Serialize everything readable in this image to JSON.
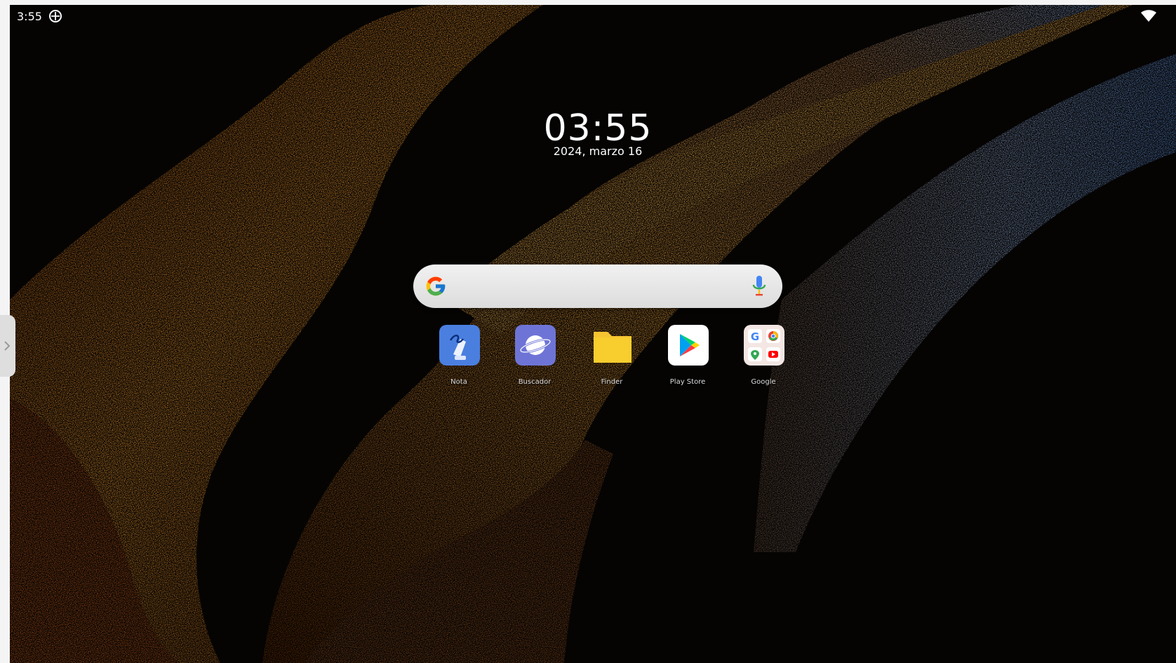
{
  "status_bar": {
    "time": "3:55",
    "sync_icon": "sync-icon",
    "wifi_icon": "wifi-icon"
  },
  "clock_widget": {
    "time": "03:55",
    "date": "2024, marzo 16"
  },
  "search_bar": {
    "logo_icon": "google-g-icon",
    "mic_icon": "mic-icon"
  },
  "apps": [
    {
      "label": "Nota",
      "icon": "notes-icon",
      "color": "#4a7fe0"
    },
    {
      "label": "Buscador",
      "icon": "browser-planet-icon",
      "color": "#6e74d6"
    },
    {
      "label": "Finder",
      "icon": "folder-icon",
      "color": "#f6c431"
    },
    {
      "label": "Play Store",
      "icon": "play-store-icon",
      "color": "#ffffff"
    },
    {
      "label": "Google",
      "icon": "google-folder-icon",
      "color": "#f3e6e3"
    }
  ],
  "colors": {
    "wallpaper_orange": "#f0902a",
    "wallpaper_blue": "#7fa6e3",
    "background": "#050403"
  }
}
